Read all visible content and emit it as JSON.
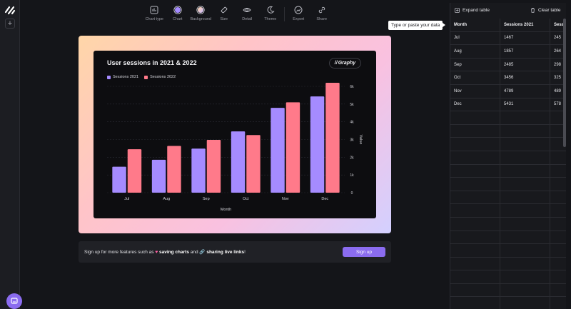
{
  "toolbar": {
    "items": [
      {
        "label": "Chart type",
        "icon": "chart-type-icon"
      },
      {
        "label": "Chart",
        "icon": "chart-color-icon"
      },
      {
        "label": "Background",
        "icon": "background-color-icon"
      },
      {
        "label": "Size",
        "icon": "size-icon"
      },
      {
        "label": "Detail",
        "icon": "eye-icon"
      },
      {
        "label": "Theme",
        "icon": "moon-icon"
      },
      {
        "label": "Export",
        "icon": "export-icon"
      },
      {
        "label": "Share",
        "icon": "link-icon"
      }
    ]
  },
  "chart_data": {
    "type": "bar",
    "title": "User sessions in 2021 & 2022",
    "categories": [
      "Jul",
      "Aug",
      "Sep",
      "Oct",
      "Nov",
      "Dec"
    ],
    "series": [
      {
        "name": "Sessions 2021",
        "values": [
          1467,
          1857,
          2485,
          3456,
          4789,
          5431
        ],
        "color": "#a58bff"
      },
      {
        "name": "Sessions 2022",
        "values": [
          2450,
          2640,
          2980,
          3250,
          5100,
          6200
        ],
        "color": "#ff7a8a"
      }
    ],
    "xlabel": "Month",
    "ylabel": "Value",
    "ylim": [
      0,
      6000
    ],
    "yticks": [
      "0",
      "1k",
      "2k",
      "3k",
      "4k",
      "5k",
      "6k"
    ],
    "grid": true,
    "legend": "top-left"
  },
  "card": {
    "brand": "Graphy"
  },
  "banner": {
    "text_pre": "Sign up for more features such as ",
    "feature1": "saving charts",
    "text_mid": " and ",
    "feature2": "sharing live links",
    "text_end": "!",
    "button": "Sign up"
  },
  "tooltip": "Type or paste your data",
  "panel": {
    "expand": "Expand table",
    "clear": "Clear table",
    "headers": [
      "Month",
      "Sessions 2021",
      "Sess"
    ],
    "rows": [
      [
        "Jul",
        "1467",
        "245"
      ],
      [
        "Aug",
        "1857",
        "264"
      ],
      [
        "Sep",
        "2485",
        "298"
      ],
      [
        "Oct",
        "3456",
        "325"
      ],
      [
        "Nov",
        "4789",
        "489"
      ],
      [
        "Dec",
        "5431",
        "578"
      ]
    ]
  },
  "colors": {
    "accent": "#8b6cf0",
    "series1": "#a58bff",
    "series2": "#ff7a8a"
  }
}
